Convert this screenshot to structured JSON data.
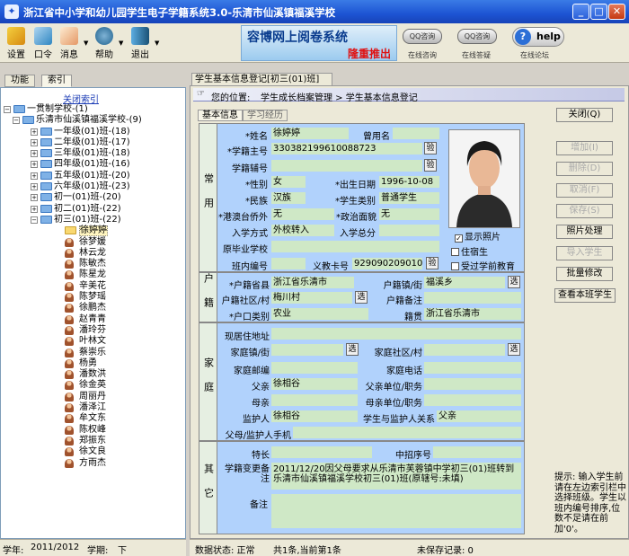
{
  "window": {
    "title": "浙江省中小学和幼儿园学生电子学籍系统3.0-乐清市仙溪镇福溪学校",
    "min": "_",
    "max": "□",
    "close": "✕"
  },
  "toolbar": {
    "items": [
      {
        "label": "设置",
        "icon": "settings-icon"
      },
      {
        "label": "口令",
        "icon": "password-icon"
      },
      {
        "label": "消息",
        "icon": "message-icon"
      },
      {
        "label": "帮助",
        "icon": "help-icon"
      },
      {
        "label": "退出",
        "icon": "exit-icon"
      }
    ]
  },
  "banner": {
    "title": "容博网上阅卷系统",
    "sub": "隆重推出"
  },
  "online": {
    "btn1": "QQ咨询",
    "btn2": "QQ咨询",
    "sub1": "在线咨询",
    "sub2": "在线答疑",
    "sub3": "在线论坛",
    "help": "help",
    "help_q": "?"
  },
  "left": {
    "tabs": [
      "功能",
      "索引"
    ],
    "close_index": "关闭索引",
    "tree": [
      {
        "label": "一贯制学校-(1)",
        "pm": "−"
      },
      {
        "label": "乐清市仙溪镇福溪学校-(9)",
        "pm": "−"
      },
      {
        "label": "一年级(01)班-(18)",
        "pm": "+"
      },
      {
        "label": "二年级(01)班-(17)",
        "pm": "+"
      },
      {
        "label": "三年级(01)班-(18)",
        "pm": "+"
      },
      {
        "label": "四年级(01)班-(16)",
        "pm": "+"
      },
      {
        "label": "五年级(01)班-(20)",
        "pm": "+"
      },
      {
        "label": "六年级(01)班-(23)",
        "pm": "+"
      },
      {
        "label": "初一(01)班-(20)",
        "pm": "+"
      },
      {
        "label": "初二(01)班-(22)",
        "pm": "+"
      },
      {
        "label": "初三(01)班-(22)",
        "pm": "−"
      }
    ],
    "students": [
      "徐婷婷",
      "徐梦媛",
      "林云龙",
      "陈敏杰",
      "陈星龙",
      "辛美花",
      "陈梦瑶",
      "徐鹏杰",
      "赵青青",
      "潘玲芬",
      "叶林文",
      "蔡崇乐",
      "杨勇",
      "潘数洪",
      "徐金英",
      "周丽丹",
      "潘泽江",
      "牟文东",
      "陈权峰",
      "郑振东",
      "徐文良",
      "方雨杰"
    ],
    "status_year_label": "学年:",
    "status_year": "2011/2012",
    "status_term_label": "学期:",
    "status_term": "下"
  },
  "form": {
    "title": "学生基本信息登记[初三(01)班]",
    "location_label": "您的位置:",
    "location": "学生成长档案管理 > 学生基本信息登记",
    "tabs": [
      "基本信息",
      "学习经历"
    ],
    "sections": [
      "常用",
      "户籍",
      "家庭",
      "其它"
    ],
    "common": {
      "name_l": "*姓名",
      "name": "徐婷婷",
      "oldname_l": "曾用名",
      "oldname": "",
      "sid_l": "*学籍主号",
      "sid": "330382199610088723",
      "check": "验",
      "sid2_l": "学籍辅号",
      "sid2": "",
      "sex_l": "*性别",
      "sex": "女",
      "birth_l": "*出生日期",
      "birth": "1996-10-08",
      "nation_l": "*民族",
      "nation": "汉族",
      "stype_l": "*学生类别",
      "stype": "普通学生",
      "hkmt_l": "*港澳台侨外",
      "hkmt": "无",
      "pol_l": "*政治面貌",
      "pol": "无",
      "entry_l": "入学方式",
      "entry": "外校转入",
      "score_l": "入学总分",
      "score": "",
      "origin_l": "原毕业学校",
      "origin": "",
      "classno_l": "班内编号",
      "classno": "",
      "card_l": "义教卡号",
      "card": "92909020901037"
    },
    "photo": {
      "show": "显示照片",
      "boarder": "住宿生",
      "preschool": "受过学前教育"
    },
    "household": {
      "prov_l": "*户籍省县",
      "prov": "浙江省乐清市",
      "town_l": "户籍镇/街",
      "town": "福溪乡",
      "village_l": "户籍社区/村",
      "village": "梅川村",
      "sel": "选",
      "note_l": "户籍备注",
      "note": "",
      "type_l": "*户口类别",
      "type": "农业",
      "native_l": "籍贯",
      "native": "浙江省乐清市"
    },
    "family": {
      "addr_l": "现居住地址",
      "addr": "",
      "ftown_l": "家庭镇/街",
      "ftown": "",
      "fvil_l": "家庭社区/村",
      "fvil": "",
      "fzip_l": "家庭邮编",
      "fzip": "",
      "fphone_l": "家庭电话",
      "fphone": "",
      "father_l": "父亲",
      "father": "徐相谷",
      "fwork_l": "父亲单位/职务",
      "fwork": "",
      "mother_l": "母亲",
      "mother": "",
      "mwork_l": "母亲单位/职务",
      "mwork": "",
      "guard_l": "监护人",
      "guard": "徐相谷",
      "rel_l": "学生与监护人关系",
      "rel": "父亲",
      "gphone_l": "父母/监护人手机",
      "gphone": ""
    },
    "other": {
      "spec_l": "特长",
      "spec": "",
      "recruit_l": "中招序号",
      "recruit": "",
      "change_l": "学籍变更备注",
      "change": "2011/12/20因父母要求从乐清市芙蓉镇中学初三(01)班转到乐清市仙溪镇福溪学校初三(01)班(原辖号:未填)",
      "remark_l": "备注",
      "remark": ""
    },
    "buttons": [
      "关闭(Q)",
      "增加(I)",
      "删除(D)",
      "取消(F)",
      "保存(S)",
      "照片处理",
      "导入学生",
      "批量修改",
      "查看本班学生"
    ],
    "tip": "提示: 输入学生前请在左边索引栏中选择班级。学生以班内编号排序,位数不足请在前加'0'。",
    "status": "数据状态: 正常",
    "count": "共1条,当前第1条",
    "unsaved": "未保存记录: 0"
  }
}
